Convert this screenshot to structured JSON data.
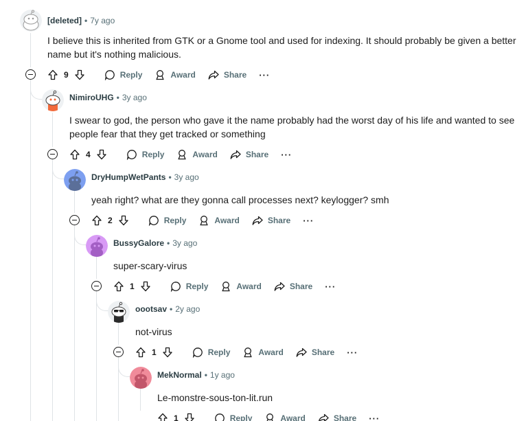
{
  "comments": [
    {
      "author": "[deleted]",
      "time": "7y ago",
      "body": [
        "I believe this is inherited from GTK or a Gnome tool and used for indexing. It should probably be given a better",
        "name but it's nothing malicious."
      ],
      "votes": "9",
      "avatar": "deleted-avatar"
    },
    {
      "author": "NimiroUHG",
      "time": "3y ago",
      "body": [
        "I swear to god, the person who gave it the name probably had the worst day of his life and wanted to see",
        "people fear that they get tracked or something"
      ],
      "votes": "4",
      "avatar": "snoo-orange-avatar"
    },
    {
      "author": "DryHumpWetPants",
      "time": "3y ago",
      "body": [
        "yeah right? what are they gonna call processes next? keylogger? smh"
      ],
      "votes": "2",
      "avatar": "snoo-blue-avatar"
    },
    {
      "author": "BussyGalore",
      "time": "3y ago",
      "body": [
        "super-scary-virus"
      ],
      "votes": "1",
      "avatar": "snoo-purple-avatar"
    },
    {
      "author": "oootsav",
      "time": "2y ago",
      "body": [
        "not-virus"
      ],
      "votes": "1",
      "avatar": "snoo-sunglasses-avatar"
    },
    {
      "author": "MekNormal",
      "time": "1y ago",
      "body": [
        "Le-monstre-sous-ton-lit.run"
      ],
      "votes": "1",
      "avatar": "snoo-pink-avatar"
    }
  ],
  "actions": {
    "reply": "Reply",
    "award": "Award",
    "share": "Share",
    "more": "···",
    "separator": "•"
  },
  "colors": {
    "thread_line": "#dfe3e6",
    "meta_text": "#576f76",
    "avatar_blue": "#7d9ff0",
    "avatar_purple": "#d89af5",
    "avatar_pink": "#f08b9a"
  }
}
